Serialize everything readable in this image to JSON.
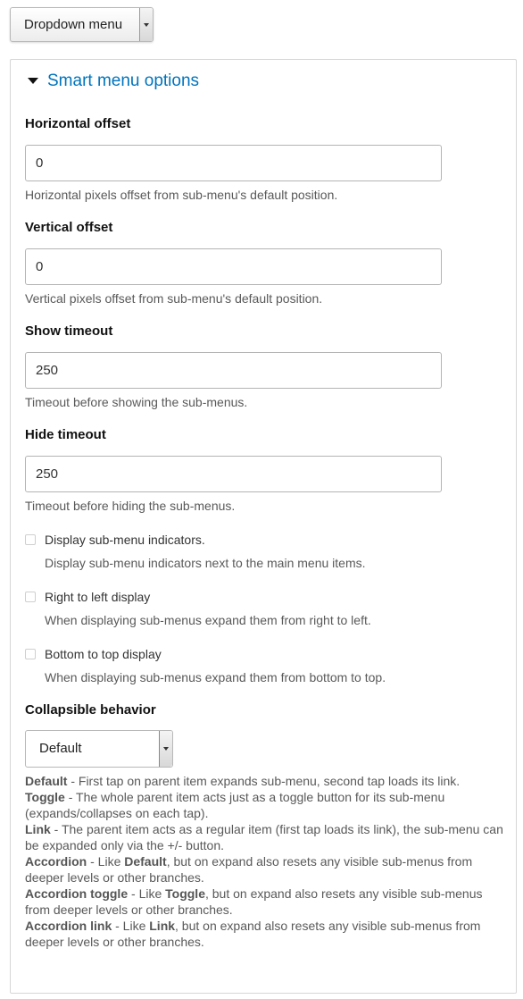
{
  "top_select": {
    "value": "Dropdown menu"
  },
  "fieldset": {
    "legend": "Smart menu options",
    "fields": [
      {
        "label": "Horizontal offset",
        "value": "0",
        "description": "Horizontal pixels offset from sub-menu's default position."
      },
      {
        "label": "Vertical offset",
        "value": "0",
        "description": "Vertical pixels offset from sub-menu's default position."
      },
      {
        "label": "Show timeout",
        "value": "250",
        "description": "Timeout before showing the sub-menus."
      },
      {
        "label": "Hide timeout",
        "value": "250",
        "description": "Timeout before hiding the sub-menus."
      }
    ],
    "checkboxes": [
      {
        "label": "Display sub-menu indicators.",
        "description": "Display sub-menu indicators next to the main menu items.",
        "checked": false
      },
      {
        "label": "Right to left display",
        "description": "When displaying sub-menus expand them from right to left.",
        "checked": false
      },
      {
        "label": "Bottom to top display",
        "description": "When displaying sub-menus expand them from bottom to top.",
        "checked": false
      }
    ],
    "collapsible": {
      "label": "Collapsible behavior",
      "value": "Default",
      "explanations": [
        {
          "parts": [
            {
              "b": "Default"
            },
            {
              "t": " - First tap on parent item expands sub-menu, second tap loads its link."
            }
          ]
        },
        {
          "parts": [
            {
              "b": "Toggle"
            },
            {
              "t": " - The whole parent item acts just as a toggle button for its sub-menu (expands/collapses on each tap)."
            }
          ]
        },
        {
          "parts": [
            {
              "b": "Link"
            },
            {
              "t": " - The parent item acts as a regular item (first tap loads its link), the sub-menu can be expanded only via the +/- button."
            }
          ]
        },
        {
          "parts": [
            {
              "b": "Accordion"
            },
            {
              "t": " - Like "
            },
            {
              "b": "Default"
            },
            {
              "t": ", but on expand also resets any visible sub-menus from deeper levels or other branches."
            }
          ]
        },
        {
          "parts": [
            {
              "b": "Accordion toggle"
            },
            {
              "t": " - Like "
            },
            {
              "b": "Toggle"
            },
            {
              "t": ", but on expand also resets any visible sub-menus from deeper levels or other branches."
            }
          ]
        },
        {
          "parts": [
            {
              "b": "Accordion link"
            },
            {
              "t": " - Like "
            },
            {
              "b": "Link"
            },
            {
              "t": ", but on expand also resets any visible sub-menus from deeper levels or other branches."
            }
          ]
        }
      ]
    }
  },
  "colors": {
    "link": "#0074bd",
    "border": "#d6d6d6",
    "description": "#595959"
  }
}
